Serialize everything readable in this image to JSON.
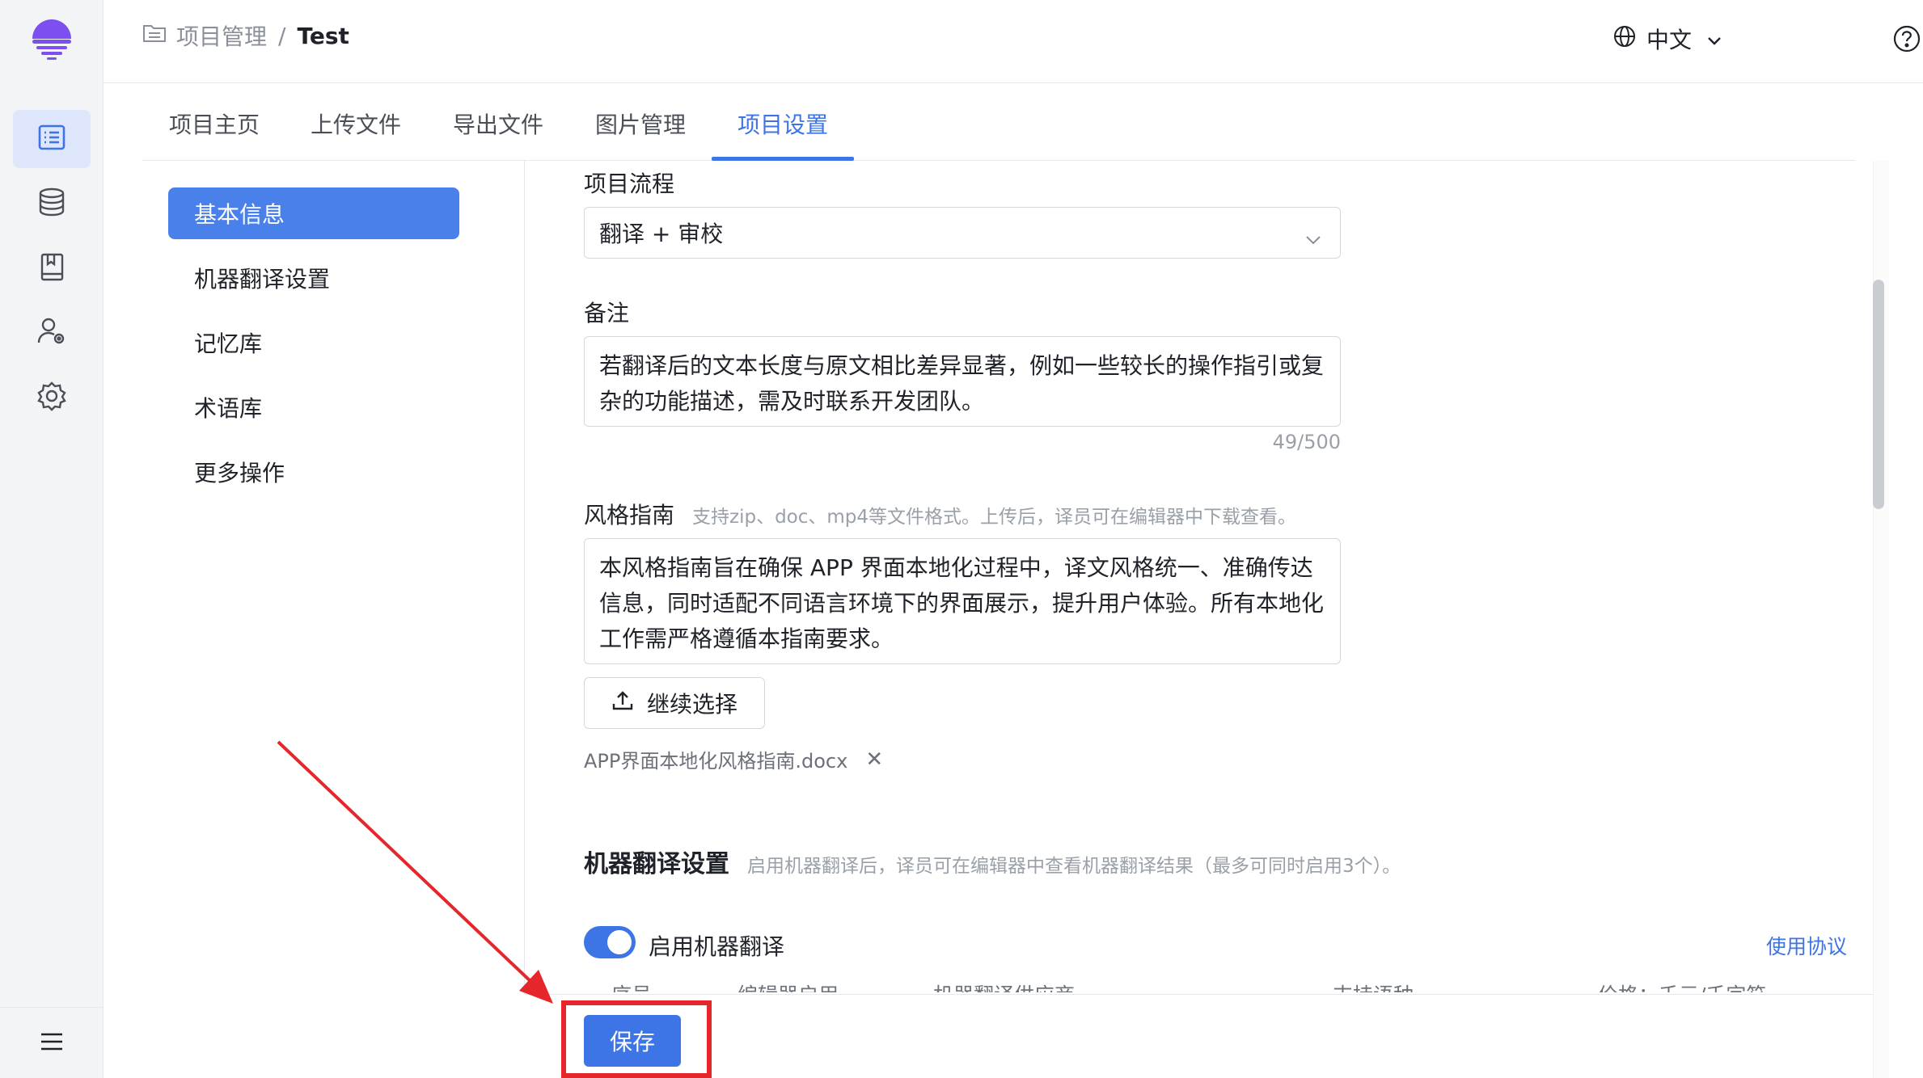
{
  "breadcrumb": {
    "root": "项目管理",
    "sep": "/",
    "current": "Test"
  },
  "header": {
    "language": "中文"
  },
  "tabs": [
    "项目主页",
    "上传文件",
    "导出文件",
    "图片管理",
    "项目设置"
  ],
  "subnav": [
    "基本信息",
    "机器翻译设置",
    "记忆库",
    "术语库",
    "更多操作"
  ],
  "form": {
    "workflow_label": "项目流程",
    "workflow_value": "翻译 + 审校",
    "notes_label": "备注",
    "notes_line1": "若翻译后的文本长度与原文相比差异显著，例如一些较长的操作指引或复",
    "notes_line2": "杂的功能描述，需及时联系开发团队。",
    "notes_counter": "49/500",
    "style_label": "风格指南",
    "style_hint": "支持zip、doc、mp4等文件格式。上传后，译员可在编辑器中下载查看。",
    "style_line1": "本风格指南旨在确保 APP 界面本地化过程中，译文风格统一、准确传达",
    "style_line2": "信息，同时适配不同语言环境下的界面展示，提升用户体验。所有本地化",
    "style_line3": "工作需严格遵循本指南要求。",
    "upload_label": "继续选择",
    "file_name": "APP界面本地化风格指南.docx",
    "file_remove": "✕"
  },
  "mt": {
    "title": "机器翻译设置",
    "hint": "启用机器翻译后，译员可在编辑器中查看机器翻译结果（最多可同时启用3个）。",
    "toggle_label": "启用机器翻译",
    "toggle_on": true,
    "agreement_link": "使用协议",
    "columns": [
      "序号",
      "编辑器启用",
      "机器翻译供应商",
      "支持语种",
      "价格：千元/千字符"
    ]
  },
  "footer": {
    "save_label": "保存"
  },
  "colors": {
    "accent": "#3d74e6",
    "annotation": "#e5262a"
  }
}
